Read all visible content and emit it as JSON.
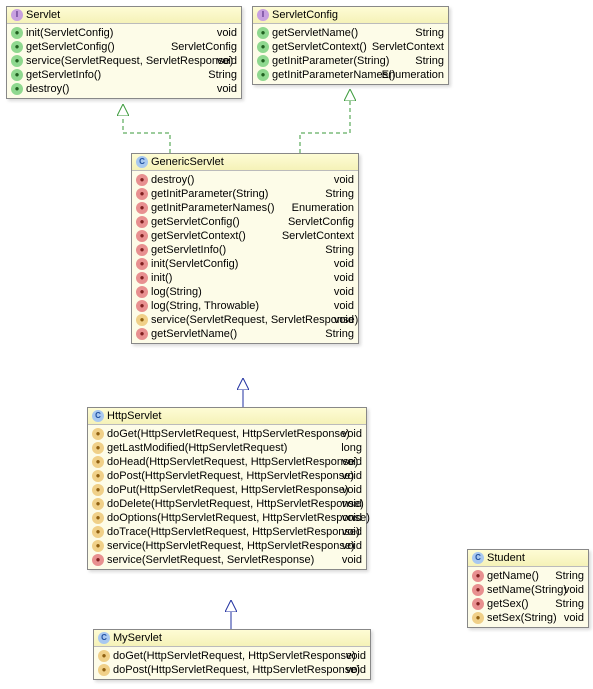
{
  "chart_data": {
    "type": "uml_class_diagram",
    "relations": [
      {
        "from": "GenericServlet",
        "to": "Servlet",
        "type": "realization"
      },
      {
        "from": "GenericServlet",
        "to": "ServletConfig",
        "type": "realization"
      },
      {
        "from": "HttpServlet",
        "to": "GenericServlet",
        "type": "inheritance"
      },
      {
        "from": "MyServlet",
        "to": "HttpServlet",
        "type": "inheritance"
      }
    ]
  },
  "classes": {
    "servlet": {
      "name": "Servlet",
      "stereotype": "interface",
      "methods": [
        {
          "sig": "init(ServletConfig)",
          "ret": "void",
          "icon": "pub"
        },
        {
          "sig": "getServletConfig()",
          "ret": "ServletConfig",
          "icon": "pub"
        },
        {
          "sig": "service(ServletRequest, ServletResponse)",
          "ret": "void",
          "icon": "pub"
        },
        {
          "sig": "getServletInfo()",
          "ret": "String",
          "icon": "pub"
        },
        {
          "sig": "destroy()",
          "ret": "void",
          "icon": "pub"
        }
      ]
    },
    "servletConfig": {
      "name": "ServletConfig",
      "stereotype": "interface",
      "methods": [
        {
          "sig": "getServletName()",
          "ret": "String",
          "icon": "pub"
        },
        {
          "sig": "getServletContext()",
          "ret": "ServletContext",
          "icon": "pub"
        },
        {
          "sig": "getInitParameter(String)",
          "ret": "String",
          "icon": "pub"
        },
        {
          "sig": "getInitParameterNames()",
          "ret": "Enumeration",
          "icon": "pub"
        }
      ]
    },
    "genericServlet": {
      "name": "GenericServlet",
      "stereotype": "class",
      "methods": [
        {
          "sig": "destroy()",
          "ret": "void",
          "icon": "red"
        },
        {
          "sig": "getInitParameter(String)",
          "ret": "String",
          "icon": "red"
        },
        {
          "sig": "getInitParameterNames()",
          "ret": "Enumeration",
          "icon": "red"
        },
        {
          "sig": "getServletConfig()",
          "ret": "ServletConfig",
          "icon": "red"
        },
        {
          "sig": "getServletContext()",
          "ret": "ServletContext",
          "icon": "red"
        },
        {
          "sig": "getServletInfo()",
          "ret": "String",
          "icon": "red"
        },
        {
          "sig": "init(ServletConfig)",
          "ret": "void",
          "icon": "red"
        },
        {
          "sig": "init()",
          "ret": "void",
          "icon": "red"
        },
        {
          "sig": "log(String)",
          "ret": "void",
          "icon": "red"
        },
        {
          "sig": "log(String, Throwable)",
          "ret": "void",
          "icon": "red"
        },
        {
          "sig": "service(ServletRequest, ServletResponse)",
          "ret": "void",
          "icon": "prot"
        },
        {
          "sig": "getServletName()",
          "ret": "String",
          "icon": "red"
        }
      ]
    },
    "httpServlet": {
      "name": "HttpServlet",
      "stereotype": "class",
      "methods": [
        {
          "sig": "doGet(HttpServletRequest, HttpServletResponse)",
          "ret": "void",
          "icon": "prot"
        },
        {
          "sig": "getLastModified(HttpServletRequest)",
          "ret": "long",
          "icon": "prot"
        },
        {
          "sig": "doHead(HttpServletRequest, HttpServletResponse)",
          "ret": "void",
          "icon": "prot"
        },
        {
          "sig": "doPost(HttpServletRequest, HttpServletResponse)",
          "ret": "void",
          "icon": "prot"
        },
        {
          "sig": "doPut(HttpServletRequest, HttpServletResponse)",
          "ret": "void",
          "icon": "prot"
        },
        {
          "sig": "doDelete(HttpServletRequest, HttpServletResponse)",
          "ret": "void",
          "icon": "prot"
        },
        {
          "sig": "doOptions(HttpServletRequest, HttpServletResponse)",
          "ret": "void",
          "icon": "prot"
        },
        {
          "sig": "doTrace(HttpServletRequest, HttpServletResponse)",
          "ret": "void",
          "icon": "prot"
        },
        {
          "sig": "service(HttpServletRequest, HttpServletResponse)",
          "ret": "void",
          "icon": "prot"
        },
        {
          "sig": "service(ServletRequest, ServletResponse)",
          "ret": "void",
          "icon": "red"
        }
      ]
    },
    "myServlet": {
      "name": "MyServlet",
      "stereotype": "class",
      "methods": [
        {
          "sig": "doGet(HttpServletRequest, HttpServletResponse)",
          "ret": "void",
          "icon": "prot"
        },
        {
          "sig": "doPost(HttpServletRequest, HttpServletResponse)",
          "ret": "void",
          "icon": "prot"
        }
      ]
    },
    "student": {
      "name": "Student",
      "stereotype": "class",
      "methods": [
        {
          "sig": "getName()",
          "ret": "String",
          "icon": "red"
        },
        {
          "sig": "setName(String)",
          "ret": "void",
          "icon": "red"
        },
        {
          "sig": "getSex()",
          "ret": "String",
          "icon": "red"
        },
        {
          "sig": "setSex(String)",
          "ret": "void",
          "icon": "prot"
        }
      ]
    }
  }
}
